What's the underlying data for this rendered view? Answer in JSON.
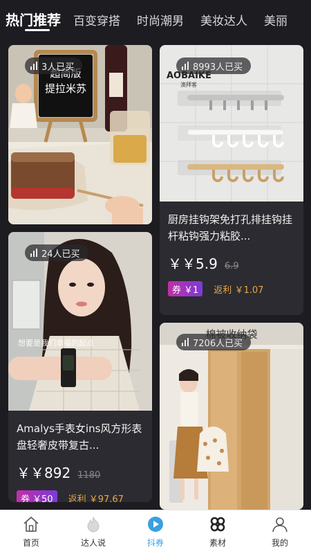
{
  "tabs": [
    {
      "label": "热门推荐",
      "active": true
    },
    {
      "label": "百变穿搭",
      "active": false
    },
    {
      "label": "时尚潮男",
      "active": false
    },
    {
      "label": "美妆达人",
      "active": false
    },
    {
      "label": "美丽",
      "active": false
    }
  ],
  "products": {
    "tiramisu": {
      "sold": "3人已买",
      "sign_line1": "超简版",
      "sign_line2": "提拉米苏"
    },
    "hook": {
      "sold": "8993人已买",
      "brand": "AOBAIKE",
      "brand_cn": "澳拜客",
      "title": "厨房挂钩架免打孔排挂钩挂杆粘钩强力粘胶...",
      "price": "￥5.9",
      "original_price": "6.9",
      "coupon": "￥1",
      "rebate": "￥1.07"
    },
    "watch": {
      "sold": "24人已买",
      "caption": "想要是我们幸福的起点",
      "title": "Amalys手表女ins风方形表盘轻奢皮带复古...",
      "price": "￥892",
      "original_price": "1180",
      "coupon": "￥50",
      "rebate": "￥97.67"
    },
    "storage": {
      "sold": "7206人已买",
      "banner": "棉被收纳袋"
    }
  },
  "labels": {
    "currency": "￥",
    "coupon": "券",
    "rebate": "返利"
  },
  "nav": [
    {
      "label": "首页",
      "icon": "home-icon",
      "active": false
    },
    {
      "label": "达人说",
      "icon": "flame-icon",
      "active": false
    },
    {
      "label": "抖券",
      "icon": "play-icon",
      "active": true
    },
    {
      "label": "素材",
      "icon": "clover-icon",
      "active": false
    },
    {
      "label": "我的",
      "icon": "user-icon",
      "active": false
    }
  ],
  "colors": {
    "background": "#1d1c21",
    "card": "#2c2b31",
    "rebate": "#e6a843",
    "coupon_start": "#c02fa8",
    "coupon_end": "#7c3ad8",
    "nav_active": "#3aa0e0"
  }
}
